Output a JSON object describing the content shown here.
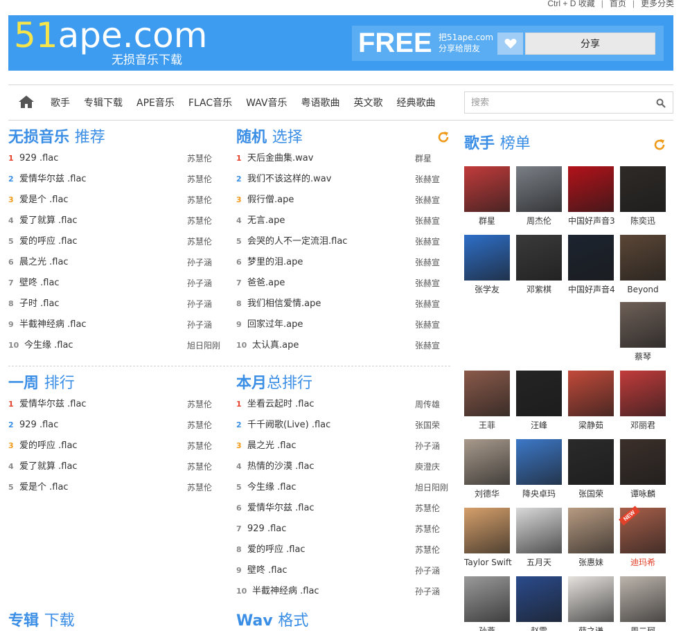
{
  "toplinks": {
    "bookmark": "Ctrl + D 收藏",
    "home": "首页",
    "more": "更多分类"
  },
  "header": {
    "logo_num": "51",
    "logo_rest": "ape.com",
    "logo_sub": "无损音乐下载",
    "free": "FREE",
    "free_sub1": "把51ape.com",
    "free_sub2": "分享给朋友",
    "share": "分享"
  },
  "nav": {
    "items": [
      "歌手",
      "专辑下载",
      "APE音乐",
      "FLAC音乐",
      "WAV音乐",
      "粤语歌曲",
      "英文歌",
      "经典歌曲"
    ],
    "search_placeholder": "搜索"
  },
  "sections": {
    "lossless": {
      "title": "无损音乐",
      "sub": "推荐",
      "songs": [
        {
          "rank": "1",
          "title": "929 .flac",
          "artist": "苏慧伦"
        },
        {
          "rank": "2",
          "title": "爱情华尔兹 .flac",
          "artist": "苏慧伦"
        },
        {
          "rank": "3",
          "title": "爱是个 .flac",
          "artist": "苏慧伦"
        },
        {
          "rank": "4",
          "title": "爱了就算 .flac",
          "artist": "苏慧伦"
        },
        {
          "rank": "5",
          "title": "爱的呼应 .flac",
          "artist": "苏慧伦"
        },
        {
          "rank": "6",
          "title": "晨之光 .flac",
          "artist": "孙子涵"
        },
        {
          "rank": "7",
          "title": "壁咚 .flac",
          "artist": "孙子涵"
        },
        {
          "rank": "8",
          "title": "子时 .flac",
          "artist": "孙子涵"
        },
        {
          "rank": "9",
          "title": "半截神经病 .flac",
          "artist": "孙子涵"
        },
        {
          "rank": "10",
          "title": "今生缘 .flac",
          "artist": "旭日阳刚"
        }
      ]
    },
    "random": {
      "title": "随机",
      "sub": "选择",
      "songs": [
        {
          "rank": "1",
          "title": "天后金曲集.wav",
          "artist": "群星"
        },
        {
          "rank": "2",
          "title": "我们不该这样的.wav",
          "artist": "张赫宣"
        },
        {
          "rank": "3",
          "title": "假行僧.ape",
          "artist": "张赫宣"
        },
        {
          "rank": "4",
          "title": "无言.ape",
          "artist": "张赫宣"
        },
        {
          "rank": "5",
          "title": "会哭的人不一定流泪.flac",
          "artist": "张赫宣"
        },
        {
          "rank": "6",
          "title": "梦里的泪.ape",
          "artist": "张赫宣"
        },
        {
          "rank": "7",
          "title": "爸爸.ape",
          "artist": "张赫宣"
        },
        {
          "rank": "8",
          "title": "我们相信爱情.ape",
          "artist": "张赫宣"
        },
        {
          "rank": "9",
          "title": "回家过年.ape",
          "artist": "张赫宣"
        },
        {
          "rank": "10",
          "title": "太认真.ape",
          "artist": "张赫宣"
        }
      ]
    },
    "week": {
      "title": "一周",
      "sub": "排行",
      "songs": [
        {
          "rank": "1",
          "title": "爱情华尔兹 .flac",
          "artist": "苏慧伦"
        },
        {
          "rank": "2",
          "title": "929 .flac",
          "artist": "苏慧伦"
        },
        {
          "rank": "3",
          "title": "爱的呼应 .flac",
          "artist": "苏慧伦"
        },
        {
          "rank": "4",
          "title": "爱了就算 .flac",
          "artist": "苏慧伦"
        },
        {
          "rank": "5",
          "title": "爱是个 .flac",
          "artist": "苏慧伦"
        }
      ]
    },
    "month": {
      "title": "本月",
      "sub": "总排行",
      "songs": [
        {
          "rank": "1",
          "title": "坐看云起时 .flac",
          "artist": "周传雄"
        },
        {
          "rank": "2",
          "title": "千千阙歌(Live) .flac",
          "artist": "张国荣"
        },
        {
          "rank": "3",
          "title": "晨之光 .flac",
          "artist": "孙子涵"
        },
        {
          "rank": "4",
          "title": "热情的沙漠 .flac",
          "artist": "庾澄庆"
        },
        {
          "rank": "5",
          "title": "今生缘 .flac",
          "artist": "旭日阳刚"
        },
        {
          "rank": "6",
          "title": "爱情华尔兹 .flac",
          "artist": "苏慧伦"
        },
        {
          "rank": "7",
          "title": "929 .flac",
          "artist": "苏慧伦"
        },
        {
          "rank": "8",
          "title": "爱的呼应 .flac",
          "artist": "苏慧伦"
        },
        {
          "rank": "9",
          "title": "壁咚 .flac",
          "artist": "孙子涵"
        },
        {
          "rank": "10",
          "title": "半截神经病 .flac",
          "artist": "孙子涵"
        }
      ]
    },
    "album": {
      "title": "专辑",
      "sub": "下载"
    },
    "wav": {
      "title": "Wav",
      "sub": "格式"
    }
  },
  "singers": {
    "title": "歌手",
    "sub": "榜单",
    "list": [
      {
        "name": "群星",
        "color": "#c23b3b"
      },
      {
        "name": "周杰伦",
        "color": "#7a7f86"
      },
      {
        "name": "中国好声音3",
        "color": "#b3121a"
      },
      {
        "name": "陈奕迅",
        "color": "#2e2a27"
      },
      {
        "name": "张学友",
        "color": "#2e6fc8"
      },
      {
        "name": "邓紫棋",
        "color": "#3a3a3a"
      },
      {
        "name": "中国好声音4",
        "color": "#1c2430"
      },
      {
        "name": "Beyond",
        "color": "#5b4636"
      },
      {
        "name": "蔡琴",
        "color": "#6e6058"
      },
      {
        "name": "王菲",
        "color": "#8a5a4a"
      },
      {
        "name": "汪峰",
        "color": "#242424"
      },
      {
        "name": "梁静茹",
        "color": "#c24a3a"
      },
      {
        "name": "邓丽君",
        "color": "#c23b3b"
      },
      {
        "name": "刘德华",
        "color": "#a89a8c"
      },
      {
        "name": "降央卓玛",
        "color": "#3c78c8"
      },
      {
        "name": "张国荣",
        "color": "#2a2a2a"
      },
      {
        "name": "谭咏麟",
        "color": "#3b2f2a"
      },
      {
        "name": "Taylor Swift",
        "color": "#d6a06b"
      },
      {
        "name": "五月天",
        "color": "#d9d9d9"
      },
      {
        "name": "张惠妹",
        "color": "#b89b82"
      },
      {
        "name": "迪玛希",
        "color": "#a85f4a",
        "badge": "NEW"
      },
      {
        "name": "孙燕",
        "color": "#9a9a9a"
      },
      {
        "name": "赵雷",
        "color": "#2a4b8c"
      },
      {
        "name": "薛之谦",
        "color": "#e6e2de"
      },
      {
        "name": "周二珂",
        "color": "#bdb5ad"
      }
    ]
  }
}
